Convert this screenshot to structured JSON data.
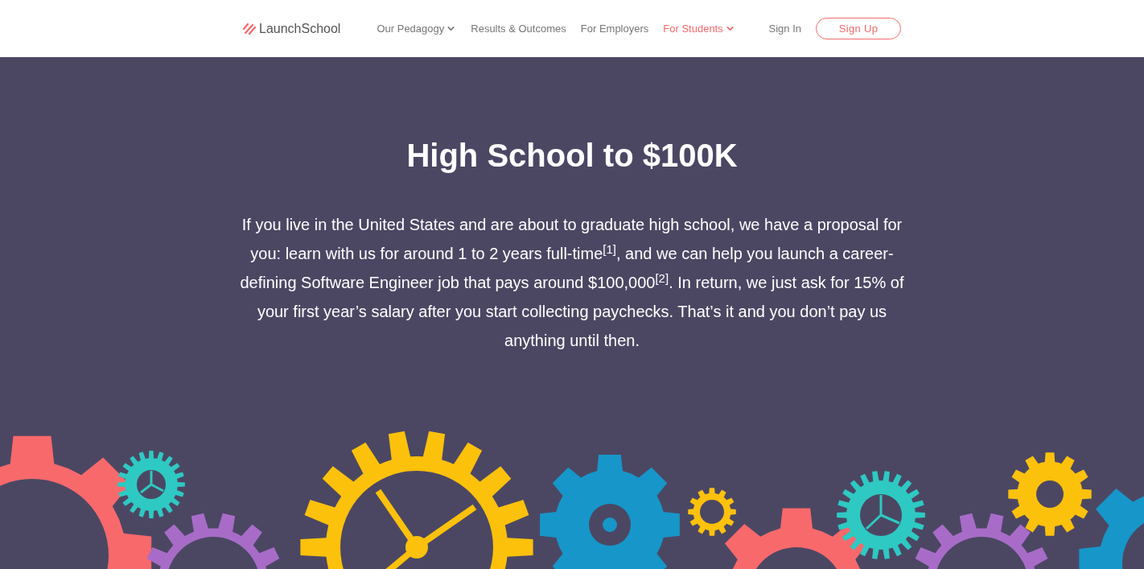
{
  "header": {
    "logo": "LaunchSchool",
    "nav": [
      {
        "label": "Our Pedagogy",
        "dropdown": true,
        "selected": false
      },
      {
        "label": "Results & Outcomes",
        "dropdown": false,
        "selected": false
      },
      {
        "label": "For Employers",
        "dropdown": false,
        "selected": false
      },
      {
        "label": "For Students",
        "dropdown": true,
        "selected": true
      }
    ],
    "sign_in": "Sign In",
    "sign_up": "Sign Up"
  },
  "hero": {
    "title": "High School to $100K",
    "text": "If you live in the United States and are about to graduate high school, we have a proposal for you: learn with us for around 1 to 2 years full-time$^{[1]}$, and we can help you launch a career-defining Software Engineer job that pays around $100,000$^{[2]}$. In return, we just ask for 15% of your first year’s salary after you start collecting paychecks. That’s it and you don’t pay us anything until then."
  }
}
